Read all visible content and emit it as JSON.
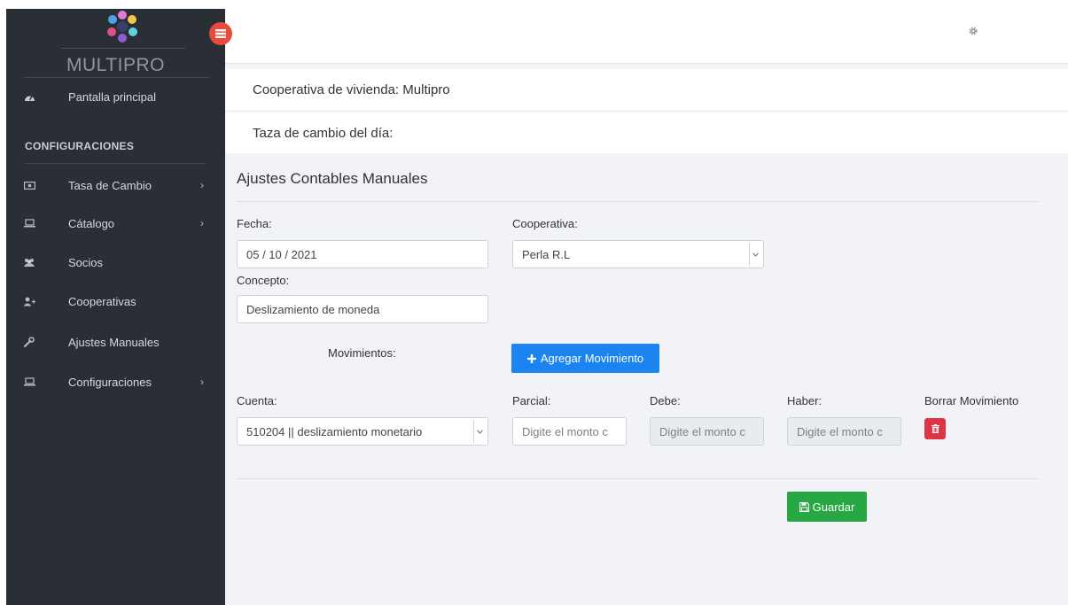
{
  "brand": {
    "name": "MULTIPRO"
  },
  "sidebar": {
    "dashboard_label": "Pantalla principal",
    "section_heading": "CONFIGURACIONES",
    "items": [
      {
        "label": "Tasa de Cambio",
        "icon": "money-icon",
        "has_submenu": true
      },
      {
        "label": "Cátalogo",
        "icon": "laptop-icon",
        "has_submenu": true
      },
      {
        "label": "Socios",
        "icon": "users-icon",
        "has_submenu": false
      },
      {
        "label": "Cooperativas",
        "icon": "user-plus-icon",
        "has_submenu": false
      },
      {
        "label": "Ajustes Manuales",
        "icon": "wrench-icon",
        "has_submenu": false
      },
      {
        "label": "Configuraciones",
        "icon": "laptop-icon",
        "has_submenu": true
      }
    ]
  },
  "header": {
    "cooperative_line": "Cooperativa de vivienda: Multipro",
    "exchange_line": "Taza de cambio del día:"
  },
  "form": {
    "title": "Ajustes Contables Manuales",
    "fecha_label": "Fecha:",
    "fecha_value": "05 / 10 / 2021",
    "cooperativa_label": "Cooperativa:",
    "cooperativa_value": "Perla R.L",
    "concepto_label": "Concepto:",
    "concepto_value": "Deslizamiento de moneda",
    "movimientos_label": "Movimientos:",
    "add_button": "Agregar Movimiento",
    "columns": {
      "cuenta": "Cuenta:",
      "parcial": "Parcial:",
      "debe": "Debe:",
      "haber": "Haber:",
      "borrar": "Borrar Movimiento"
    },
    "row": {
      "cuenta_value": "510204 || deslizamiento monetario",
      "parcial_placeholder": "Digite el monto c",
      "debe_placeholder": "Digite el monto c",
      "haber_placeholder": "Digite el monto c"
    },
    "save_button": "Guardar"
  },
  "colors": {
    "sidebar_bg": "#2a2f35",
    "primary": "#1b84f0",
    "danger": "#dc3545",
    "success": "#28a745",
    "toggle": "#e84b3c"
  }
}
